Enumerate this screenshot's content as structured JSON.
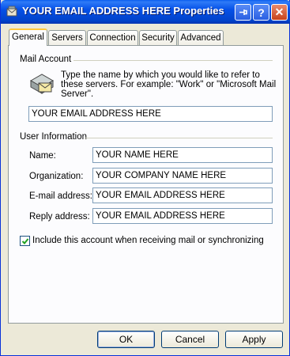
{
  "window": {
    "title": "YOUR EMAIL ADDRESS HERE Properties",
    "app_icon": "mail-server-icon",
    "help_label": "?",
    "close_label": "✕"
  },
  "tabs": [
    {
      "label": "General",
      "active": true
    },
    {
      "label": "Servers"
    },
    {
      "label": "Connection"
    },
    {
      "label": "Security"
    },
    {
      "label": "Advanced"
    }
  ],
  "mail_account": {
    "group_label": "Mail Account",
    "description": "Type the name by which you would like to refer to these servers.  For example: \"Work\" or \"Microsoft Mail Server\".",
    "account_name": "YOUR EMAIL ADDRESS HERE"
  },
  "user_info": {
    "group_label": "User Information",
    "name_label": "Name:",
    "name_value": "YOUR NAME HERE",
    "org_label": "Organization:",
    "org_value": "YOUR COMPANY NAME HERE",
    "email_label": "E-mail address:",
    "email_value": "YOUR EMAIL ADDRESS HERE",
    "reply_label": "Reply address:",
    "reply_value": "YOUR EMAIL ADDRESS HERE"
  },
  "include_checkbox": {
    "label": "Include this account when receiving mail or synchronizing",
    "checked": true
  },
  "buttons": {
    "ok": "OK",
    "cancel": "Cancel",
    "apply": "Apply"
  },
  "colors": {
    "titlebar": "#0551e8",
    "tab_highlight": "#ffc83c",
    "dialog_bg": "#ece9d8"
  }
}
